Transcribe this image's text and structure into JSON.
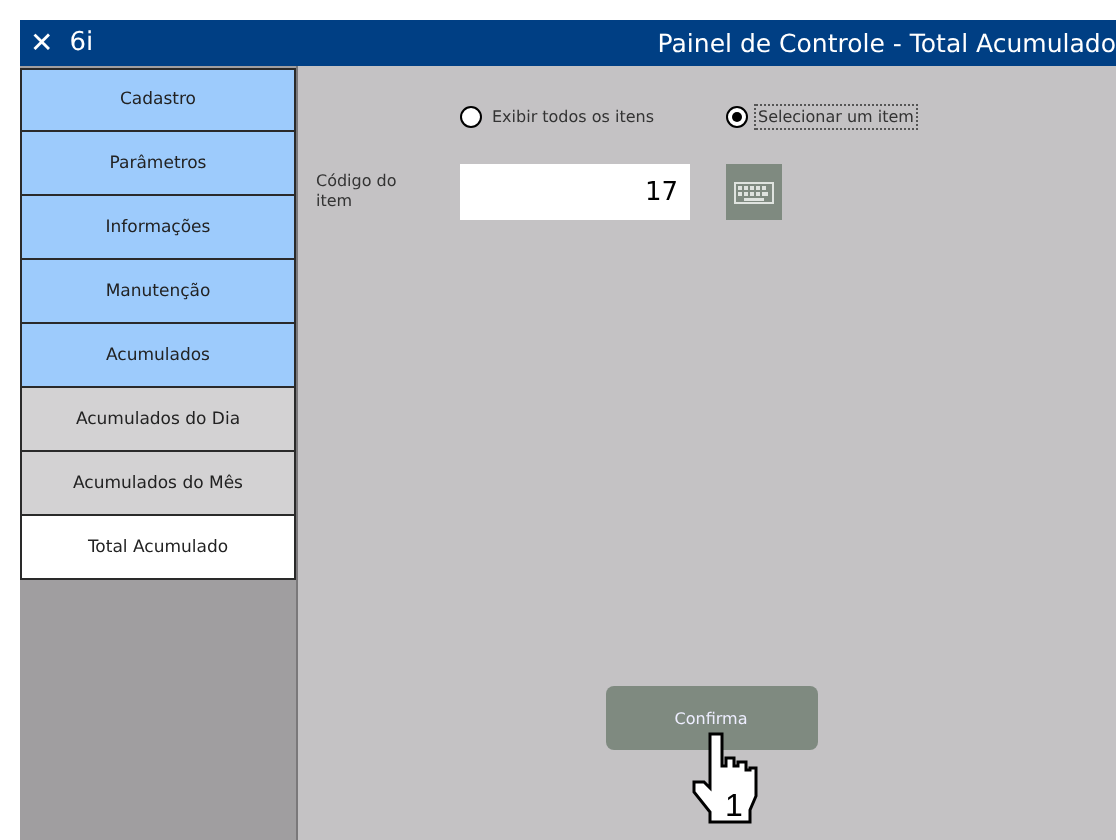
{
  "window": {
    "close": "✕",
    "app": "6i",
    "title": "Painel de Controle - Total Acumulado"
  },
  "sidebar": {
    "items": [
      {
        "label": "Cadastro",
        "kind": "section",
        "selected": false
      },
      {
        "label": "Parâmetros",
        "kind": "section",
        "selected": false
      },
      {
        "label": "Informações",
        "kind": "section",
        "selected": false
      },
      {
        "label": "Manutenção",
        "kind": "section",
        "selected": false
      },
      {
        "label": "Acumulados",
        "kind": "section",
        "selected": false
      },
      {
        "label": "Acumulados do Dia",
        "kind": "subitem",
        "selected": false
      },
      {
        "label": "Acumulados do Mês",
        "kind": "subitem",
        "selected": false
      },
      {
        "label": "Total Acumulado",
        "kind": "subitem",
        "selected": true
      }
    ]
  },
  "options": [
    {
      "label": "Exibir todos os itens",
      "selected": false
    },
    {
      "label": "Selecionar um item",
      "selected": true
    }
  ],
  "item_code": {
    "label": "Código do item",
    "value": "17"
  },
  "confirm_button": "Confirma",
  "cursor": {
    "label": "1"
  }
}
